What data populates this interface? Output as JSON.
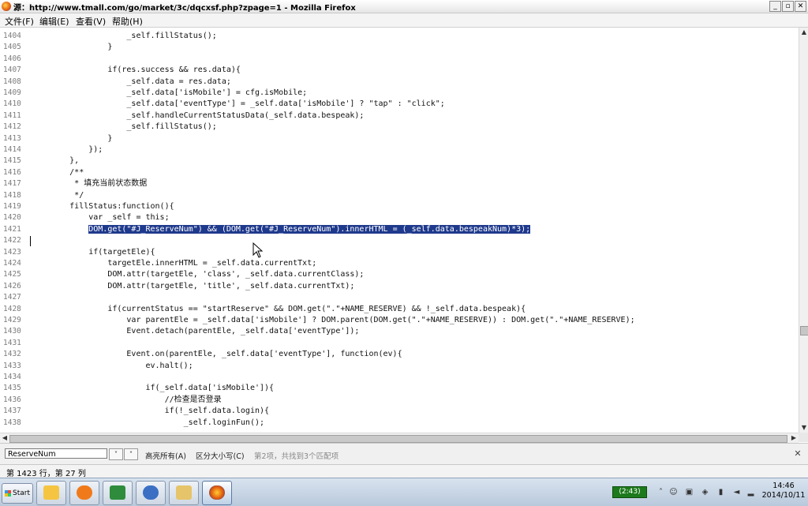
{
  "window": {
    "title": "源：http://www.tmall.com/go/market/3c/dqcxsf.php?zpage=1 - Mozilla Firefox",
    "buttons": [
      "_",
      "▫",
      "✕"
    ]
  },
  "menu": [
    "文件(F)",
    "编辑(E)",
    "查看(V)",
    "帮助(H)"
  ],
  "code_lines": [
    {
      "n": "1404",
      "text": "                    _self.fillStatus();"
    },
    {
      "n": "1405",
      "text": "                }"
    },
    {
      "n": "1406",
      "text": ""
    },
    {
      "n": "1407",
      "text": "                if(res.success && res.data){"
    },
    {
      "n": "1408",
      "text": "                    _self.data = res.data;"
    },
    {
      "n": "1409",
      "text": "                    _self.data['isMobile'] = cfg.isMobile;"
    },
    {
      "n": "1410",
      "text": "                    _self.data['eventType'] = _self.data['isMobile'] ? \"tap\" : \"click\";"
    },
    {
      "n": "1411",
      "text": "                    _self.handleCurrentStatusData(_self.data.bespeak);"
    },
    {
      "n": "1412",
      "text": "                    _self.fillStatus();"
    },
    {
      "n": "1413",
      "text": "                }"
    },
    {
      "n": "1414",
      "text": "            });"
    },
    {
      "n": "1415",
      "text": "        },"
    },
    {
      "n": "1416",
      "text": "        /**"
    },
    {
      "n": "1417",
      "text": "         * 填充当前状态数据"
    },
    {
      "n": "1418",
      "text": "         */"
    },
    {
      "n": "1419",
      "text": "        fillStatus:function(){"
    },
    {
      "n": "1420",
      "text": "            var _self = this;"
    },
    {
      "n": "1421",
      "text": "            DOM.get(\"#J_ReserveNum\") && (DOM.get(\"#J_ReserveNum\").innerHTML = (_self.data.bespeakNum)*3);"
    },
    {
      "n": "1422",
      "text": ""
    },
    {
      "n": "1423",
      "text": "            if(targetEle){"
    },
    {
      "n": "1424",
      "text": "                targetEle.innerHTML = _self.data.currentTxt;"
    },
    {
      "n": "1425",
      "text": "                DOM.attr(targetEle, 'class', _self.data.currentClass);"
    },
    {
      "n": "1426",
      "text": "                DOM.attr(targetEle, 'title', _self.data.currentTxt);"
    },
    {
      "n": "1427",
      "text": ""
    },
    {
      "n": "1428",
      "text": "                if(currentStatus == \"startReserve\" && DOM.get(\".\"+NAME_RESERVE) && !_self.data.bespeak){"
    },
    {
      "n": "1429",
      "text": "                    var parentEle = _self.data['isMobile'] ? DOM.parent(DOM.get(\".\"+NAME_RESERVE)) : DOM.get(\".\"+NAME_RESERVE);"
    },
    {
      "n": "1430",
      "text": "                    Event.detach(parentEle, _self.data['eventType']);"
    },
    {
      "n": "1431",
      "text": ""
    },
    {
      "n": "1432",
      "text": "                    Event.on(parentEle, _self.data['eventType'], function(ev){"
    },
    {
      "n": "1433",
      "text": "                        ev.halt();"
    },
    {
      "n": "1434",
      "text": ""
    },
    {
      "n": "1435",
      "text": "                        if(_self.data['isMobile']){"
    },
    {
      "n": "1436",
      "text": "                            //检查是否登录"
    },
    {
      "n": "1437",
      "text": "                            if(!_self.data.login){"
    },
    {
      "n": "1438",
      "text": "                                _self.loginFun();"
    }
  ],
  "highlighted_line": "1421",
  "find_bar": {
    "input_value": "ReserveNum",
    "highlight_all": "高亮所有(A)",
    "match_case": "区分大小写(C)",
    "status": "第2项，共找到3个匹配项"
  },
  "status_bar": {
    "position": "第 1423 行，第 27 列"
  },
  "taskbar": {
    "start_label": "Start",
    "battery": "(2:43)",
    "clock_time": "14:46",
    "clock_date": "2014/10/11"
  },
  "colors": {
    "selection": "#1f3a8c",
    "line_number": "#7c7c7c"
  }
}
